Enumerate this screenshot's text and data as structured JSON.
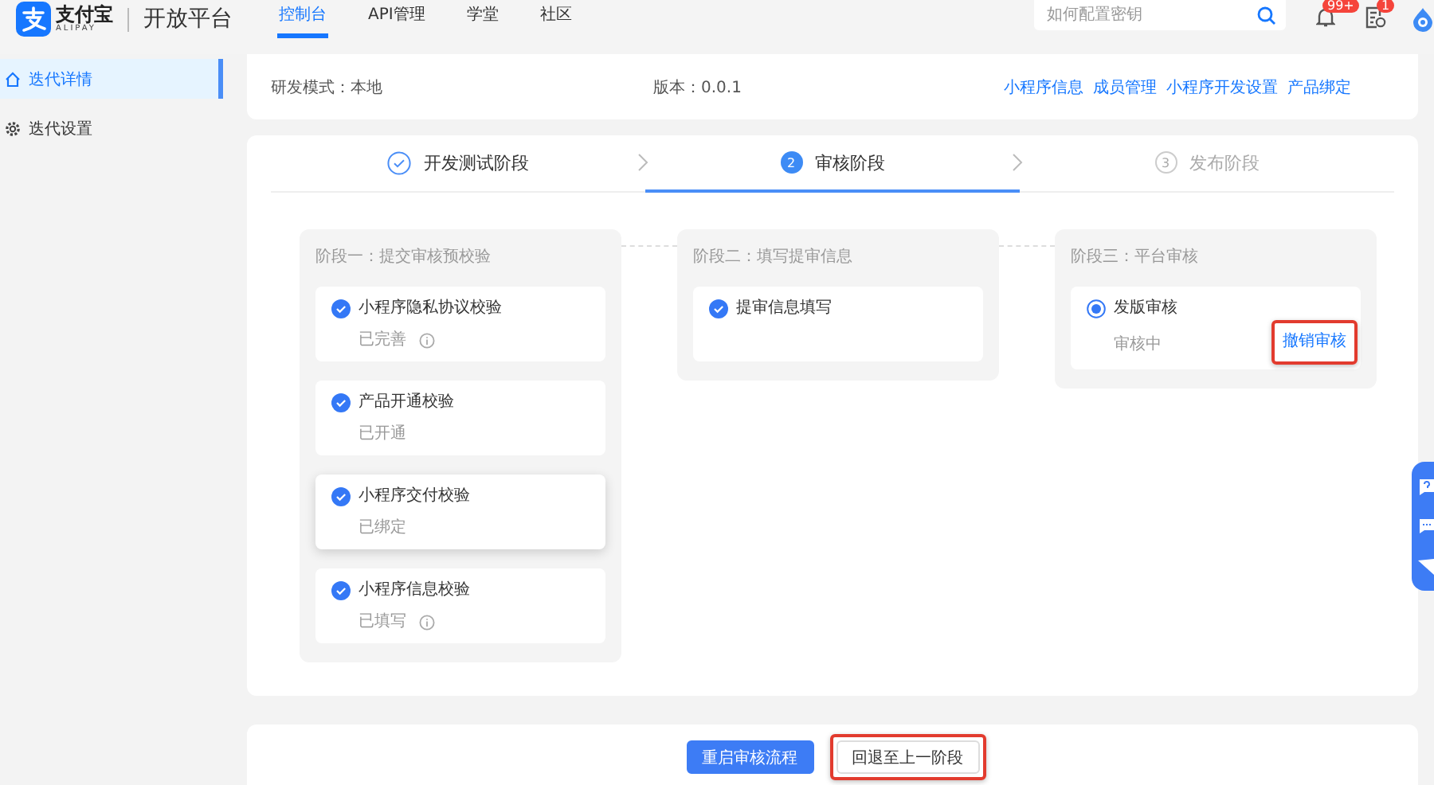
{
  "header": {
    "logo": {
      "brand": "支付宝",
      "brand_sub": "ALIPAY",
      "product": "开放平台"
    },
    "nav": [
      {
        "label": "控制台",
        "selected": true
      },
      {
        "label": "API管理",
        "selected": false
      },
      {
        "label": "学堂",
        "selected": false
      },
      {
        "label": "社区",
        "selected": false
      }
    ],
    "search": {
      "placeholder": "如何配置密钥"
    },
    "notifications": {
      "badge": "99+"
    },
    "tasks": {
      "badge": "1"
    }
  },
  "sidebar": {
    "items": [
      {
        "label": "迭代详情",
        "selected": true
      },
      {
        "label": "迭代设置",
        "selected": false
      }
    ]
  },
  "info": {
    "fields": [
      "研发模式：本地",
      "版本：0.0.1"
    ],
    "links": [
      "小程序信息",
      "成员管理",
      "小程序开发设置",
      "产品绑定"
    ]
  },
  "steps": [
    {
      "label": "开发测试阶段",
      "done": true,
      "selected": false
    },
    {
      "number": "2",
      "label": "审核阶段",
      "done": false,
      "selected": true
    },
    {
      "number": "3",
      "label": "发布阶段",
      "done": false,
      "selected": false
    }
  ],
  "stages": [
    {
      "title": "阶段一：提交审核预校验",
      "items": [
        {
          "kind": "check",
          "title": "小程序隐私协议校验",
          "status": "已完善",
          "info": true,
          "raised": false
        },
        {
          "kind": "check",
          "title": "产品开通校验",
          "status": "已开通",
          "info": false,
          "raised": false
        },
        {
          "kind": "check",
          "title": "小程序交付校验",
          "status": "已绑定",
          "info": false,
          "raised": true
        },
        {
          "kind": "check",
          "title": "小程序信息校验",
          "status": "已填写",
          "info": true,
          "raised": false
        }
      ]
    },
    {
      "title": "阶段二：填写提审信息",
      "items": [
        {
          "kind": "check",
          "title": "提审信息填写",
          "info": false,
          "raised": false
        }
      ]
    },
    {
      "title": "阶段三：平台审核",
      "items": [
        {
          "kind": "radio",
          "title": "发版审核",
          "status": "审核中",
          "info": false,
          "raised": false,
          "action": {
            "label": "撤销审核",
            "annotated": true
          }
        }
      ]
    }
  ],
  "footer": {
    "buttons": [
      {
        "label": "重启审核流程",
        "kind": "primary",
        "annotated": false
      },
      {
        "label": "回退至上一阶段",
        "kind": "default",
        "annotated": true
      }
    ]
  }
}
